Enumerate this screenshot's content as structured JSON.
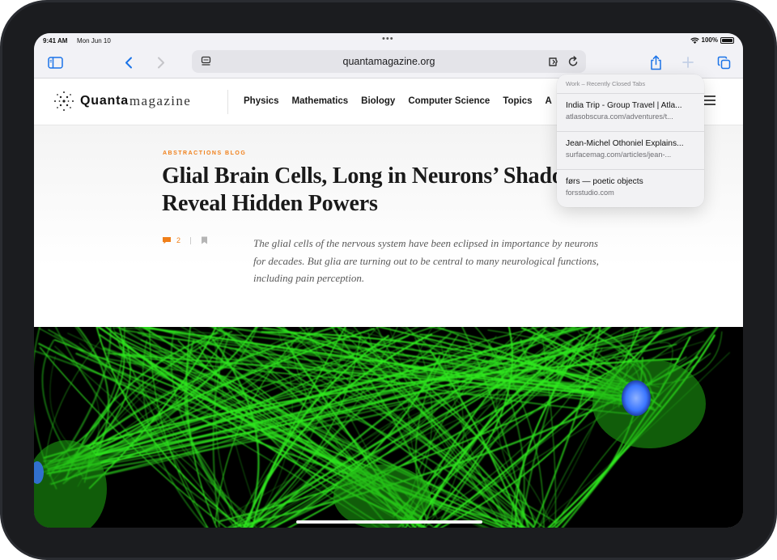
{
  "status": {
    "time": "9:41 AM",
    "date": "Mon Jun 10",
    "battery": "100%"
  },
  "browser": {
    "url": "quantamagazine.org",
    "icons": [
      "sidebar-icon",
      "back-icon",
      "forward-icon",
      "reader-icon",
      "extension-icon",
      "reload-icon",
      "share-icon",
      "new-tab-icon",
      "tabs-icon"
    ]
  },
  "site": {
    "logo_quanta": "Quanta",
    "logo_magazine": "magazine",
    "nav": [
      "Physics",
      "Mathematics",
      "Biology",
      "Computer Science",
      "Topics",
      "A"
    ]
  },
  "article": {
    "kicker": "ABSTRACTIONS BLOG",
    "headline": "Glial Brain Cells, Long in Neurons’ Shadow, Reveal Hidden Powers",
    "comment_count": "2",
    "summary": "The glial cells of the nervous system have been eclipsed in importance by neurons for decades. But glia are turning out to be central to many neurological functions, including pain perception."
  },
  "recently_closed": {
    "header": "Work – Recently Closed Tabs",
    "items": [
      {
        "title": "India Trip - Group Travel | Atla...",
        "url": "atlasobscura.com/adventures/t..."
      },
      {
        "title": "Jean-Michel Othoniel Explains...",
        "url": "surfacemag.com/articles/jean-..."
      },
      {
        "title": "førs — poetic objects",
        "url": "forsstudio.com"
      }
    ]
  },
  "colors": {
    "accent": "#f07f19",
    "link_blue": "#1a73e8",
    "fiber_green": "#2ee81e",
    "nucleus_blue": "#3a76ff"
  }
}
